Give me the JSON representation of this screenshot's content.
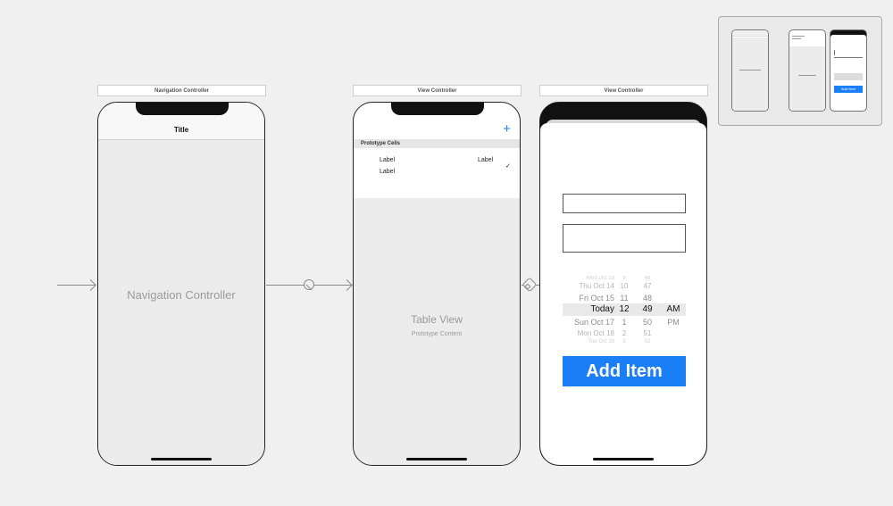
{
  "scenes": {
    "nav_controller": {
      "scene_title": "Navigation Controller",
      "nav_title": "Title",
      "body_label": "Navigation Controller"
    },
    "table_vc": {
      "scene_title": "View Controller",
      "add_icon": "plus-icon",
      "section_header": "Prototype Cells",
      "cell_title": "Label",
      "cell_subtitle": "Label",
      "cell_detail": "Label",
      "checkmark_icon": "checkmark-icon",
      "table_label": "Table View",
      "table_sublabel": "Prototype Content"
    },
    "add_vc": {
      "scene_title": "View Controller",
      "date_picker": {
        "rows": [
          {
            "date": "Wed Oct 13",
            "hour": "9",
            "minute": "46",
            "ampm": ""
          },
          {
            "date": "Thu Oct 14",
            "hour": "10",
            "minute": "47",
            "ampm": ""
          },
          {
            "date": "Fri Oct 15",
            "hour": "11",
            "minute": "48",
            "ampm": ""
          },
          {
            "date": "Today",
            "hour": "12",
            "minute": "49",
            "ampm": "AM"
          },
          {
            "date": "Sun Oct 17",
            "hour": "1",
            "minute": "50",
            "ampm": "PM"
          },
          {
            "date": "Mon Oct 18",
            "hour": "2",
            "minute": "51",
            "ampm": ""
          },
          {
            "date": "Tue Oct 19",
            "hour": "3",
            "minute": "52",
            "ampm": ""
          }
        ]
      },
      "add_button": "Add Item"
    }
  },
  "minimap": {
    "button_label": "Add Item"
  },
  "colors": {
    "accent": "#1a7ef7",
    "canvas": "#f0f0f0",
    "scene_body": "#ececec"
  }
}
